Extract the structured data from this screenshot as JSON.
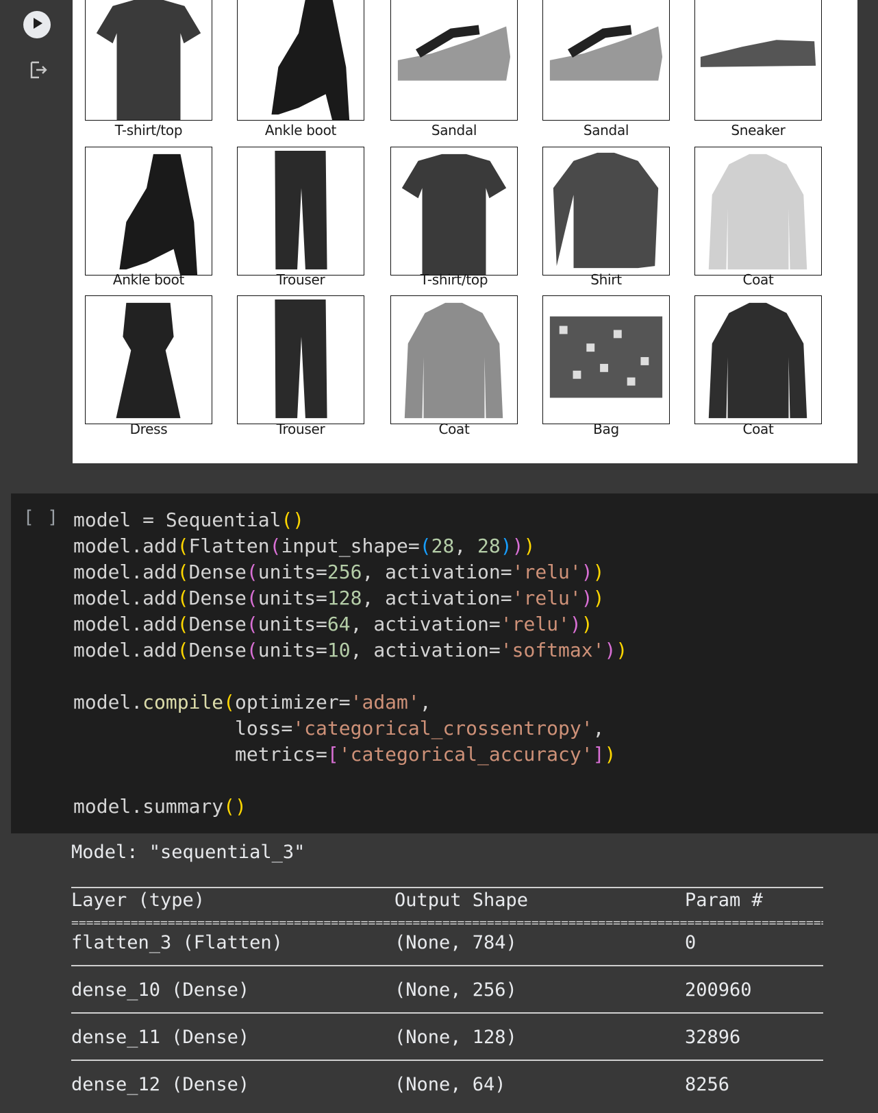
{
  "figure": {
    "labels": [
      "T-shirt/top",
      "Ankle boot",
      "Sandal",
      "Sandal",
      "Sneaker",
      "Ankle boot",
      "Trouser",
      "T-shirt/top",
      "Shirt",
      "Coat",
      "Dress",
      "Trouser",
      "Coat",
      "Bag",
      "Coat"
    ]
  },
  "code_cell": {
    "exec_count": "[ ]",
    "strings": {
      "relu": "'relu'",
      "softmax": "'softmax'",
      "adam": "'adam'",
      "loss": "'categorical_crossentropy'",
      "metric": "'categorical_accuracy'"
    }
  },
  "summary": {
    "title": "Model: \"sequential_3\"",
    "headers": [
      "Layer (type)",
      "Output Shape",
      "Param #"
    ],
    "rows": [
      [
        "flatten_3 (Flatten)",
        "(None, 784)",
        "0"
      ],
      [
        "dense_10 (Dense)",
        "(None, 256)",
        "200960"
      ],
      [
        "dense_11 (Dense)",
        "(None, 128)",
        "32896"
      ],
      [
        "dense_12 (Dense)",
        "(None, 64)",
        "8256"
      ]
    ]
  },
  "icons": {
    "run": "play-icon",
    "clear_output": "clear-output-icon"
  }
}
